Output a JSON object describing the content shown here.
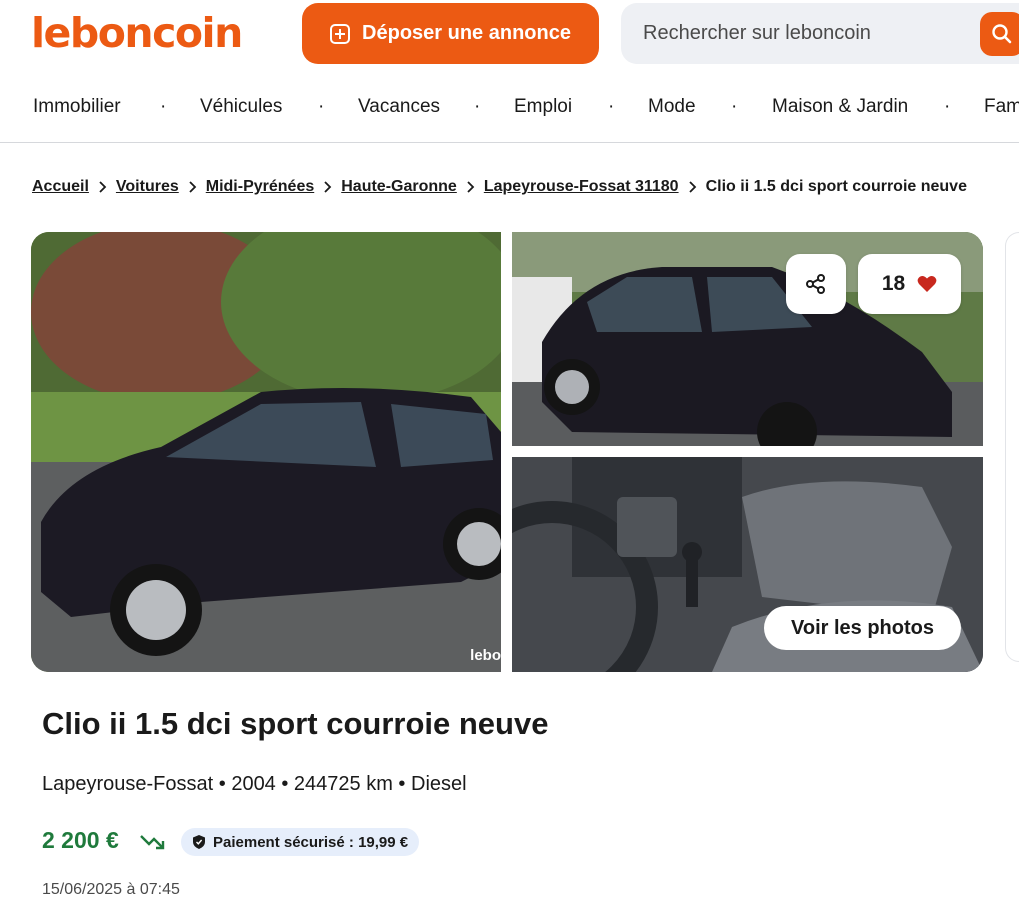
{
  "header": {
    "logo": "leboncoin",
    "post_ad_label": "Déposer une annonce",
    "search_placeholder": "Rechercher sur leboncoin"
  },
  "nav": {
    "items": [
      "Immobilier",
      "Véhicules",
      "Vacances",
      "Emploi",
      "Mode",
      "Maison & Jardin",
      "Fam"
    ],
    "separator": "·"
  },
  "breadcrumb": {
    "items": [
      "Accueil",
      "Voitures",
      "Midi-Pyrénées",
      "Haute-Garonne",
      "Lapeyrouse-Fossat 31180"
    ],
    "current": "Clio ii 1.5 dci sport courroie neuve"
  },
  "gallery": {
    "watermark": "lebo",
    "likes_count": "18",
    "see_photos_label": "Voir les photos",
    "share_icon": "share-icon",
    "like_icon": "heart-icon"
  },
  "ad": {
    "title": "Clio ii 1.5 dci sport courroie neuve",
    "meta": "Lapeyrouse-Fossat • 2004 • 244725 km • Diesel",
    "price": "2 200 €",
    "secure_payment": "Paiement sécurisé : 19,99 €",
    "date": "15/06/2025 à 07:45"
  },
  "colors": {
    "brand": "#ec5a13",
    "price": "#1f7a3c",
    "heart": "#c8281e",
    "secure_badge_bg": "#e6eefb"
  }
}
